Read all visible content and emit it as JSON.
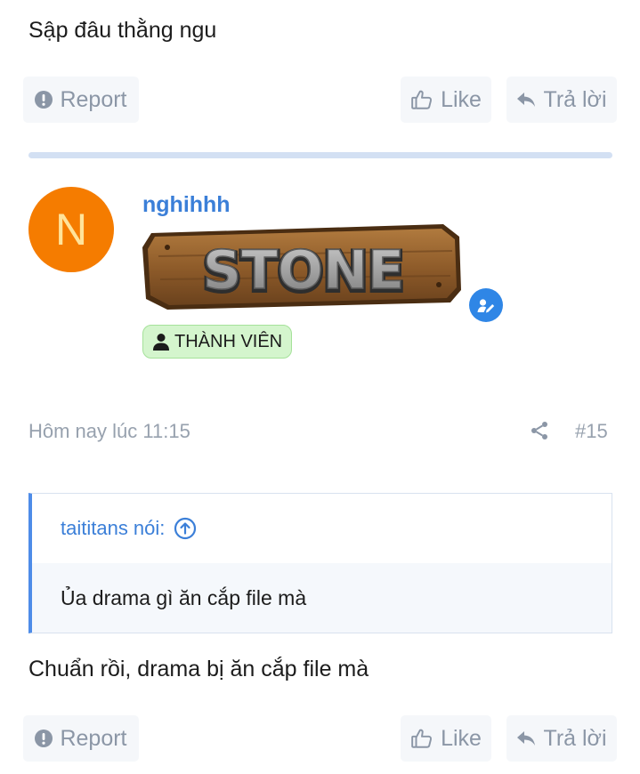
{
  "previous_post": {
    "text": "Sập đâu thằng ngu",
    "report_label": "Report",
    "like_label": "Like",
    "reply_label": "Trả lời"
  },
  "post": {
    "avatar_letter": "N",
    "username": "nghihhh",
    "rank_banner_text": "STONE",
    "role_badge": "THÀNH VIÊN",
    "timestamp": "Hôm nay lúc 11:15",
    "post_number": "#15",
    "quote": {
      "author_line": "taititans nói:",
      "text": "Ủa drama gì ăn cắp file mà"
    },
    "text": "Chuẩn rồi, drama bị ăn cắp file mà",
    "report_label": "Report",
    "like_label": "Like",
    "reply_label": "Trả lời"
  },
  "colors": {
    "accent": "#3b7fd8",
    "avatar_bg": "#f57c00",
    "badge_bg": "#d4f5cd",
    "button_bg": "#f5f7fa",
    "muted_text": "#97a1ae"
  },
  "icons": {
    "report": "exclamation-circle-icon",
    "like": "thumbs-up-icon",
    "reply": "reply-arrow-icon",
    "share": "share-icon",
    "verified": "verified-pen-icon",
    "user": "user-icon",
    "quote_jump": "arrow-up-circle-icon"
  }
}
